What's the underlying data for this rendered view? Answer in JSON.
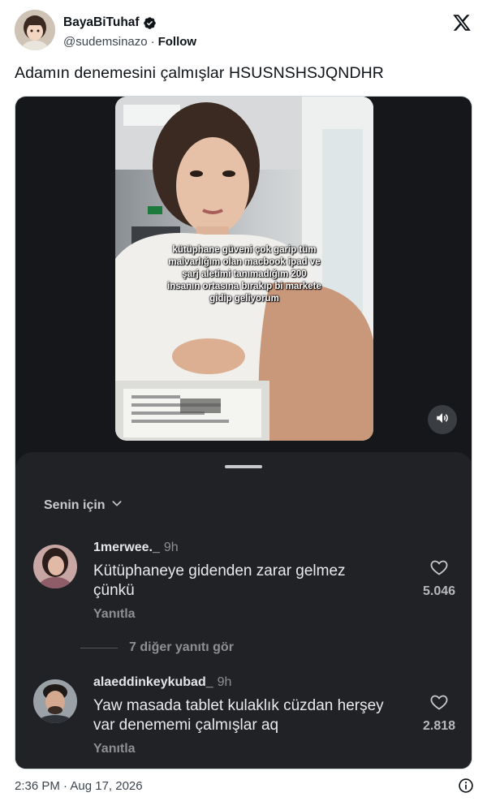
{
  "author": {
    "display_name": "BayaBiTuhaf",
    "handle": "@sudemsinazo",
    "separator": "·",
    "follow_label": "Follow"
  },
  "tweet": {
    "text": "Adamın denemesini çalmışlar HSUSNSHSJQNDHR",
    "timestamp": "2:36 PM · Aug 17, 2026"
  },
  "media": {
    "video_caption": "kütüphane güveni çok garip tüm malvarlığım olan macbook ipad ve şarj aletimi tanımadığım 200 insanın ortasına bırakıp bi markete gidip geliyorum",
    "filter_label": "Senin için",
    "more_replies": "7 diğer yanıtı gör",
    "comments": [
      {
        "username": "1merwee._",
        "time": "9h",
        "text": "Kütüphaneye gidenden zarar gelmez çünkü",
        "reply_label": "Yanıtla",
        "likes": "5.046"
      },
      {
        "username": "alaeddinkeykubad_",
        "time": "9h",
        "text": "Yaw masada tablet kulaklık cüzdan herşey var denememi çalmışlar aq",
        "reply_label": "Yanıtla",
        "likes": "2.818"
      }
    ]
  },
  "colors": {
    "verified": "#1d9bf0",
    "card_background": "#15171b",
    "sheet_background": "#202226"
  },
  "icons": [
    "verified-badge-icon",
    "x-logo-icon",
    "volume-icon",
    "chevron-down-icon",
    "heart-icon",
    "info-icon"
  ]
}
